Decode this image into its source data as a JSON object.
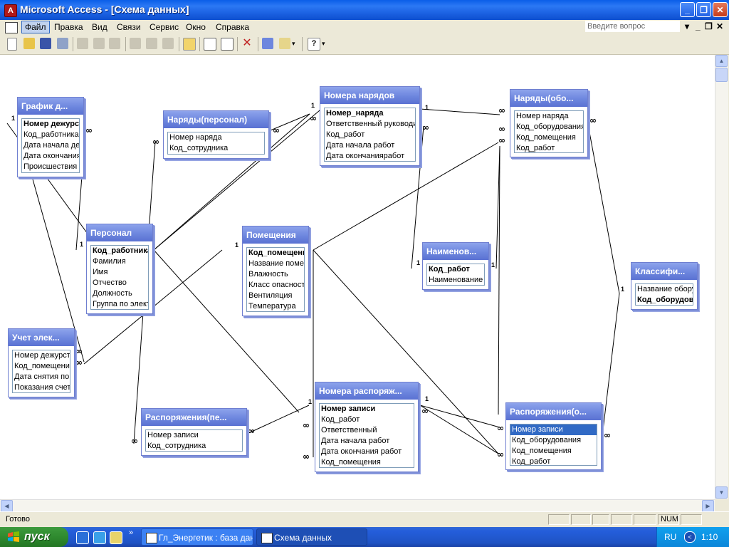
{
  "window": {
    "title": "Microsoft Access - [Схема данных]"
  },
  "menu": [
    "Файл",
    "Правка",
    "Вид",
    "Связи",
    "Сервис",
    "Окно",
    "Справка"
  ],
  "ask_placeholder": "Введите вопрос",
  "tables": {
    "grafik": {
      "title": "График д...",
      "fields": [
        "Номер дежурства",
        "Код_работника",
        "Дата начала дежурства",
        "Дата окончания",
        "Происшествия"
      ]
    },
    "naryady_pers": {
      "title": "Наряды(персонал)",
      "fields": [
        "Номер наряда",
        "Код_сотрудника"
      ]
    },
    "nomera_naryadov": {
      "title": "Номера нарядов",
      "fields": [
        "Номер_наряда",
        "Ответственный руководитель",
        "Код_работ",
        "Дата начала работ",
        "Дата окончанияработ"
      ]
    },
    "naryady_obor": {
      "title": "Наряды(обо...",
      "fields": [
        "Номер наряда",
        "Код_оборудования",
        "Код_помещения",
        "Код_работ"
      ]
    },
    "personal": {
      "title": "Персонал",
      "fields": [
        "Код_работника",
        "Фамилия",
        "Имя",
        "Отчество",
        "Должность",
        "Группа по электробезопасности"
      ]
    },
    "pomeshcheniya": {
      "title": "Помещения",
      "fields": [
        "Код_помещения",
        "Название помещения",
        "Влажность",
        "Класс опасности",
        "Вентиляция",
        "Температура"
      ]
    },
    "naimenovaniya": {
      "title": "Наименов...",
      "fields": [
        "Код_работ",
        "Наименование работ"
      ]
    },
    "klassifikator": {
      "title": "Классифи...",
      "fields": [
        "Название оборудования",
        "Код_оборудования"
      ]
    },
    "uchet": {
      "title": "Учет элек...",
      "fields": [
        "Номер дежурства",
        "Код_помещения",
        "Дата снятия показаний",
        "Показания счетчика"
      ]
    },
    "rasp_pers": {
      "title": "Распоряжения(пе...",
      "fields": [
        "Номер записи",
        "Код_сотрудника"
      ]
    },
    "nomera_rasp": {
      "title": "Номера распоряж...",
      "fields": [
        "Номер записи",
        "Код_работ",
        "Ответственный",
        "Дата начала работ",
        "Дата окончания работ",
        "Код_помещения"
      ]
    },
    "rasp_obor": {
      "title": "Распоряжения(о...",
      "fields": [
        "Номер записи",
        "Код_оборудования",
        "Код_помещения",
        "Код_работ"
      ]
    }
  },
  "status": {
    "text": "Готово",
    "num": "NUM"
  },
  "taskbar": {
    "start": "пуск",
    "task1": "Гл_Энергетик : база данных",
    "task2": "Схема данных",
    "lang": "RU",
    "clock": "1:10"
  },
  "rel_one": "1",
  "rel_many": "∞"
}
